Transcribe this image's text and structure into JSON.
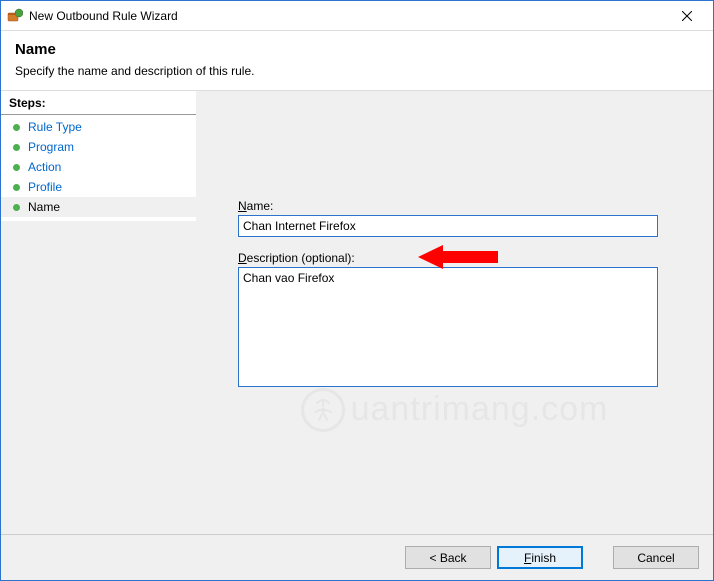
{
  "window": {
    "title": "New Outbound Rule Wizard"
  },
  "header": {
    "title": "Name",
    "subtitle": "Specify the name and description of this rule."
  },
  "sidebar": {
    "header": "Steps:",
    "items": [
      {
        "label": "Rule Type",
        "current": false
      },
      {
        "label": "Program",
        "current": false
      },
      {
        "label": "Action",
        "current": false
      },
      {
        "label": "Profile",
        "current": false
      },
      {
        "label": "Name",
        "current": true
      }
    ]
  },
  "form": {
    "name_label_pre": "N",
    "name_label_post": "ame:",
    "name_value": "Chan Internet Firefox",
    "desc_label_pre": "D",
    "desc_label_post": "escription (optional):",
    "desc_value": "Chan vao Firefox"
  },
  "buttons": {
    "back": "< Back",
    "finish": "Finish",
    "cancel": "Cancel"
  },
  "watermark": "uantrimang.com"
}
